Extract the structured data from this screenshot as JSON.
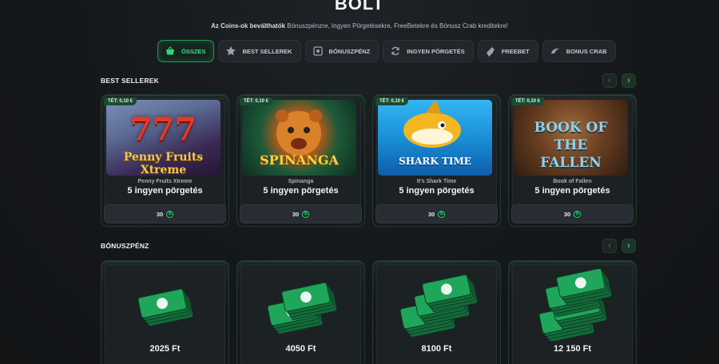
{
  "page": {
    "title": "BOLT",
    "subtitle_strong": "Az Coins-ok beválthatók",
    "subtitle_rest": " Bónuszpénzre, Ingyen Pörgetésekre, FreeBetekre és Bónusz Crab kreditekre!"
  },
  "filters": [
    {
      "label": "ÖSSZES",
      "icon": "basket-icon",
      "active": true
    },
    {
      "label": "BEST SELLEREK",
      "icon": "star-icon"
    },
    {
      "label": "BÓNUSZPÉNZ",
      "icon": "money-icon"
    },
    {
      "label": "INGYEN PÖRGETÉS",
      "icon": "spin-icon"
    },
    {
      "label": "FREEBET",
      "icon": "ticket-icon"
    },
    {
      "label": "BONUS CRAB",
      "icon": "claw-icon"
    }
  ],
  "best_sellers": {
    "title": "BEST SELLEREK",
    "cards": [
      {
        "badge": "TÉT: 0,10 €",
        "thumb_text": "777",
        "game": "Penny Fruits Xtreme",
        "offer": "5 ingyen pörgetés",
        "price": "30"
      },
      {
        "badge": "TÉT: 0,10 €",
        "thumb_text": "SPINANGA",
        "game": "Spinanga",
        "offer": "5 ingyen pörgetés",
        "price": "30"
      },
      {
        "badge": "TÉT: 0,10 €",
        "thumb_text": "SHARK TIME",
        "game": "It's Shark Time",
        "offer": "5 ingyen pörgetés",
        "price": "30"
      },
      {
        "badge": "TÉT: 0,10 €",
        "thumb_text": "BOOK OF THE FALLEN",
        "game": "Book of Fallen",
        "offer": "5 ingyen pörgetés",
        "price": "30"
      }
    ]
  },
  "bonus_money": {
    "title": "BÓNUSZPÉNZ",
    "cards": [
      {
        "amount": "2025 Ft",
        "stacks": 1
      },
      {
        "amount": "4050 Ft",
        "stacks": 2
      },
      {
        "amount": "8100 Ft",
        "stacks": 3
      },
      {
        "amount": "12 150 Ft",
        "stacks": 4
      }
    ]
  },
  "arrows": {
    "prev": "‹",
    "next": "›"
  },
  "coin_symbol": "₿",
  "colors": {
    "accent": "#2fd47e",
    "background": "#15181b"
  }
}
